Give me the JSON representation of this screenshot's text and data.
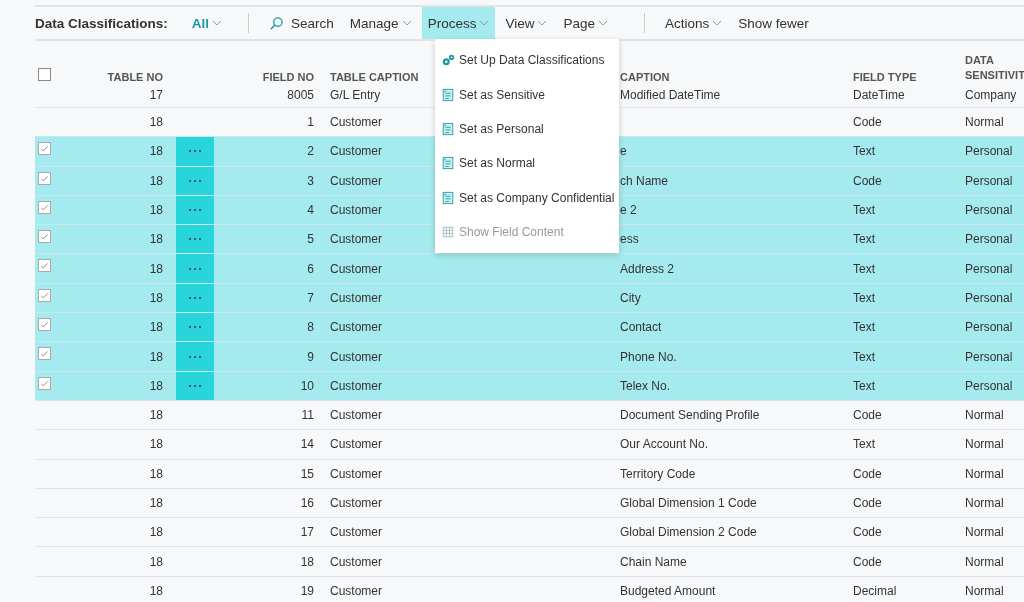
{
  "toolbar": {
    "title": "Data Classifications:",
    "filter": {
      "label": "All"
    },
    "items": [
      {
        "label": "Search",
        "kind": "search",
        "selected": false
      },
      {
        "label": "Manage",
        "kind": "menu",
        "selected": false
      },
      {
        "label": "Process",
        "kind": "menu",
        "selected": true
      },
      {
        "label": "View",
        "kind": "menu",
        "selected": false
      },
      {
        "label": "Page",
        "kind": "menu",
        "selected": false
      },
      {
        "kind": "separator"
      },
      {
        "label": "Actions",
        "kind": "menu",
        "selected": false
      },
      {
        "label": "Show fewer",
        "kind": "plain",
        "selected": false
      }
    ]
  },
  "menu": [
    {
      "label": "Set Up Data Classifications",
      "kind": "gears",
      "disabled": false
    },
    {
      "label": "Set as Sensitive",
      "kind": "document",
      "disabled": false
    },
    {
      "label": "Set as Personal",
      "kind": "document",
      "disabled": false
    },
    {
      "label": "Set as Normal",
      "kind": "document",
      "disabled": false
    },
    {
      "label": "Set as Company Confidential",
      "kind": "document",
      "disabled": false
    },
    {
      "label": "Show Field Content",
      "kind": "grid",
      "disabled": true
    }
  ],
  "table": {
    "select_all": {
      "checked": false
    },
    "columns": [
      "TABLE NO",
      "FIELD NO",
      "TABLE CAPTION",
      "CAPTION",
      "FIELD TYPE",
      "DATA SENSITIVIT"
    ],
    "rows": [
      {
        "table_no": "17",
        "field_no": "8005",
        "table_caption": "G/L Entry",
        "field_caption": "Modified DateTime",
        "field_type": "DateTime",
        "sensitivity": "Company",
        "selected": false
      },
      {
        "table_no": "18",
        "field_no": "1",
        "table_caption": "Customer",
        "field_caption": "",
        "field_type": "Code",
        "sensitivity": "Normal",
        "selected": false
      },
      {
        "table_no": "18",
        "field_no": "2",
        "table_caption": "Customer",
        "field_caption": "e",
        "field_type": "Text",
        "sensitivity": "Personal",
        "selected": true
      },
      {
        "table_no": "18",
        "field_no": "3",
        "table_caption": "Customer",
        "field_caption": "ch Name",
        "field_type": "Code",
        "sensitivity": "Personal",
        "selected": true
      },
      {
        "table_no": "18",
        "field_no": "4",
        "table_caption": "Customer",
        "field_caption": "e 2",
        "field_type": "Text",
        "sensitivity": "Personal",
        "selected": true
      },
      {
        "table_no": "18",
        "field_no": "5",
        "table_caption": "Customer",
        "field_caption": "ess",
        "field_type": "Text",
        "sensitivity": "Personal",
        "selected": true
      },
      {
        "table_no": "18",
        "field_no": "6",
        "table_caption": "Customer",
        "field_caption": "Address 2",
        "field_type": "Text",
        "sensitivity": "Personal",
        "selected": true
      },
      {
        "table_no": "18",
        "field_no": "7",
        "table_caption": "Customer",
        "field_caption": "City",
        "field_type": "Text",
        "sensitivity": "Personal",
        "selected": true
      },
      {
        "table_no": "18",
        "field_no": "8",
        "table_caption": "Customer",
        "field_caption": "Contact",
        "field_type": "Text",
        "sensitivity": "Personal",
        "selected": true
      },
      {
        "table_no": "18",
        "field_no": "9",
        "table_caption": "Customer",
        "field_caption": "Phone No.",
        "field_type": "Text",
        "sensitivity": "Personal",
        "selected": true
      },
      {
        "table_no": "18",
        "field_no": "10",
        "table_caption": "Customer",
        "field_caption": "Telex No.",
        "field_type": "Text",
        "sensitivity": "Personal",
        "selected": true
      },
      {
        "table_no": "18",
        "field_no": "11",
        "table_caption": "Customer",
        "field_caption": "Document Sending Profile",
        "field_type": "Code",
        "sensitivity": "Normal",
        "selected": false
      },
      {
        "table_no": "18",
        "field_no": "14",
        "table_caption": "Customer",
        "field_caption": "Our Account No.",
        "field_type": "Text",
        "sensitivity": "Normal",
        "selected": false
      },
      {
        "table_no": "18",
        "field_no": "15",
        "table_caption": "Customer",
        "field_caption": "Territory Code",
        "field_type": "Code",
        "sensitivity": "Normal",
        "selected": false
      },
      {
        "table_no": "18",
        "field_no": "16",
        "table_caption": "Customer",
        "field_caption": "Global Dimension 1 Code",
        "field_type": "Code",
        "sensitivity": "Normal",
        "selected": false
      },
      {
        "table_no": "18",
        "field_no": "17",
        "table_caption": "Customer",
        "field_caption": "Global Dimension 2 Code",
        "field_type": "Code",
        "sensitivity": "Normal",
        "selected": false
      },
      {
        "table_no": "18",
        "field_no": "18",
        "table_caption": "Customer",
        "field_caption": "Chain Name",
        "field_type": "Code",
        "sensitivity": "Normal",
        "selected": false
      },
      {
        "table_no": "18",
        "field_no": "19",
        "table_caption": "Customer",
        "field_caption": "Budgeted Amount",
        "field_type": "Decimal",
        "sensitivity": "Normal",
        "selected": false
      }
    ]
  }
}
